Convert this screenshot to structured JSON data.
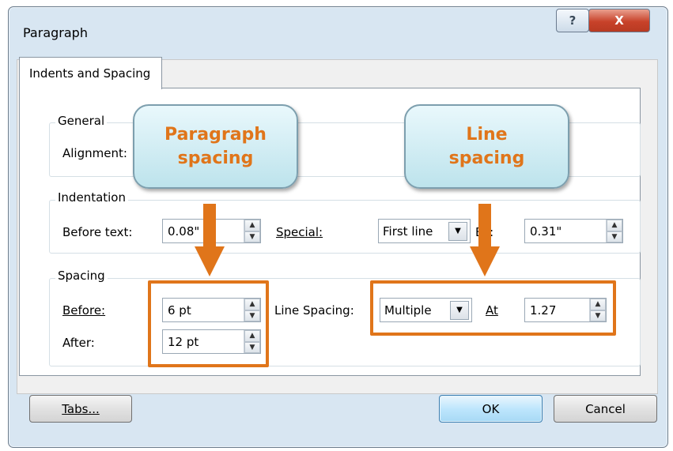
{
  "window": {
    "title": "Paragraph",
    "help_label": "?",
    "close_label": "X"
  },
  "tabs": [
    {
      "label": "Indents and Spacing"
    }
  ],
  "general": {
    "group_label": "General",
    "alignment_label": "Alignment:"
  },
  "indentation": {
    "group_label": "Indentation",
    "before_text_label": "Before text:",
    "before_text_value": "0.08\"",
    "special_label": "Special:",
    "special_value": "First line",
    "by_label": "By:",
    "by_value": "0.31\""
  },
  "spacing": {
    "group_label": "Spacing",
    "before_label": "Before:",
    "before_value": "6 pt",
    "after_label": "After:",
    "after_value": "12 pt",
    "line_spacing_label": "Line Spacing:",
    "line_spacing_value": "Multiple",
    "at_label": "At",
    "at_value": "1.27"
  },
  "footer": {
    "tabs_button": "Tabs...",
    "ok_button": "OK",
    "cancel_button": "Cancel"
  },
  "callouts": {
    "paragraph_spacing": {
      "line1": "Paragraph",
      "line2": "spacing"
    },
    "line_spacing": {
      "line1": "Line",
      "line2": "spacing"
    }
  },
  "colors": {
    "accent": "#e0751a",
    "callout_fill": "#d2eef5",
    "dialog_frame": "#d8e6f2"
  }
}
